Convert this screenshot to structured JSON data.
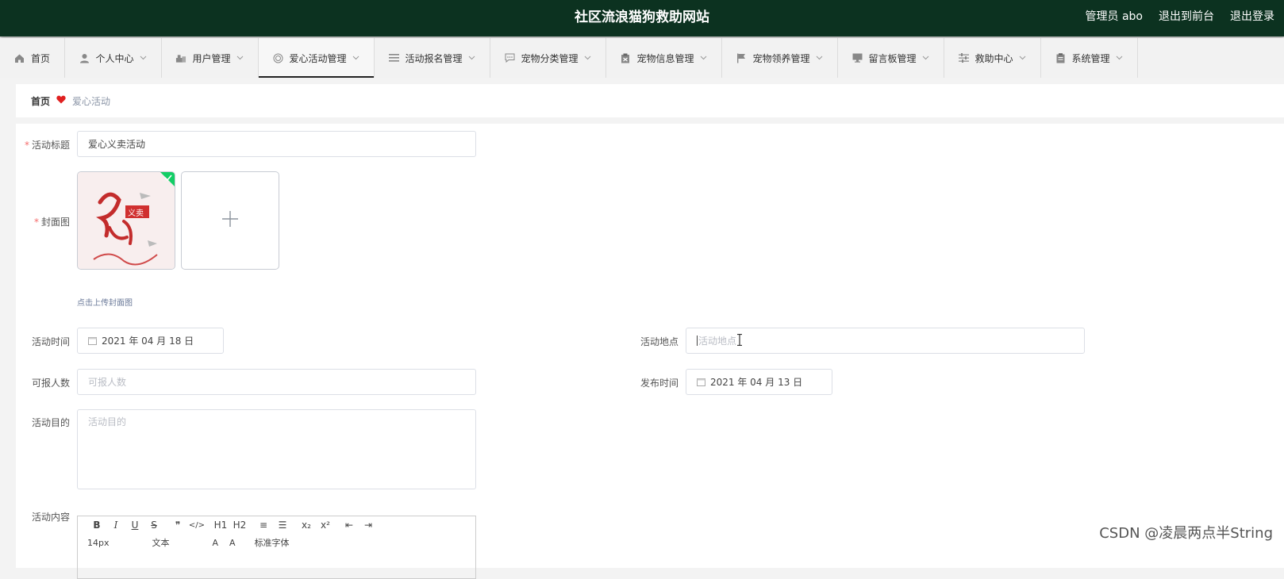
{
  "header": {
    "title": "社区流浪猫狗救助网站",
    "role_label": "管理员 abo",
    "front_label": "退出到前台",
    "logout_label": "退出登录"
  },
  "nav": {
    "items": [
      {
        "label": "首页",
        "icon": "home-icon"
      },
      {
        "label": "个人中心",
        "icon": "user-icon"
      },
      {
        "label": "用户管理",
        "icon": "users-icon"
      },
      {
        "label": "爱心活动管理",
        "icon": "target-icon",
        "active": true
      },
      {
        "label": "活动报名管理",
        "icon": "list-icon"
      },
      {
        "label": "宠物分类管理",
        "icon": "chat-icon"
      },
      {
        "label": "宠物信息管理",
        "icon": "clipboard-icon"
      },
      {
        "label": "宠物领养管理",
        "icon": "flag-icon"
      },
      {
        "label": "留言板管理",
        "icon": "monitor-icon"
      },
      {
        "label": "救助中心",
        "icon": "sliders-icon"
      },
      {
        "label": "系统管理",
        "icon": "document-icon"
      }
    ]
  },
  "breadcrumb": {
    "home": "首页",
    "current": "爱心活动"
  },
  "form": {
    "title_label": "活动标题",
    "title_value": "爱心义卖活动",
    "cover_label": "封面图",
    "cover_hint": "点击上传封面图",
    "cover_image_text": "义卖",
    "time_label": "活动时间",
    "time_value": "2021 年 04 月 18 日",
    "location_label": "活动地点",
    "location_placeholder": "活动地点",
    "count_label": "可报人数",
    "count_placeholder": "可报人数",
    "publish_label": "发布时间",
    "publish_value": "2021 年 04 月 13 日",
    "purpose_label": "活动目的",
    "purpose_placeholder": "活动目的",
    "content_label": "活动内容"
  },
  "editor": {
    "row1": [
      "B",
      "I",
      "U",
      "S",
      "❞",
      "</>",
      "H1",
      "H2",
      "≡",
      "☰",
      "x₂",
      "x²",
      "⇤",
      "⇥"
    ],
    "size": "14px",
    "text_type": "文本",
    "font": "标准字体"
  },
  "watermark": "CSDN @凌晨两点半String",
  "colors": {
    "header_bg": "#0c3220",
    "required": "#f56c6c",
    "success": "#13ce66",
    "heart": "#e02020"
  }
}
